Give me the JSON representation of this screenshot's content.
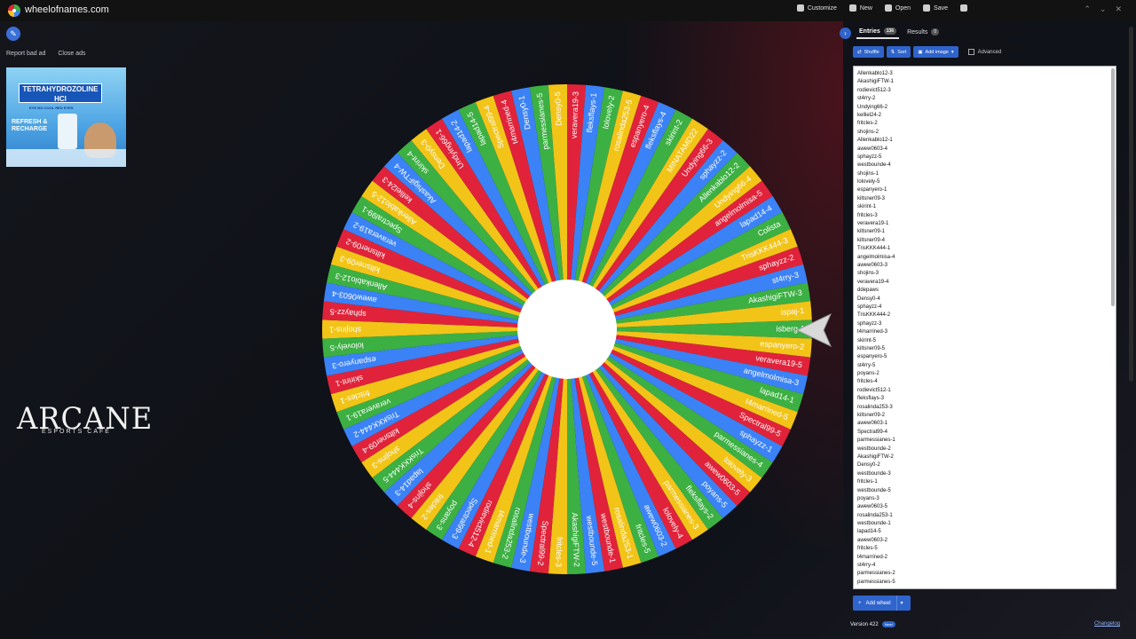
{
  "topbar": {
    "site_title": "wheelofnames.com",
    "actions": [
      {
        "label": "Customize",
        "icon": "palette-icon"
      },
      {
        "label": "New",
        "icon": "new-file-icon"
      },
      {
        "label": "Open",
        "icon": "folder-icon"
      },
      {
        "label": "Save",
        "icon": "save-icon"
      }
    ]
  },
  "ads": {
    "report_label": "Report bad ad",
    "close_label": "Close ads",
    "ad_title": "TETRAHYDROZOLINE HCl",
    "ad_sub": "EYE MO COOL RED EYES",
    "ad_refresh": "REFRESH & RECHARGE"
  },
  "branding": {
    "arcane_word": "ARCANE",
    "arcane_sub": "ESPORTS CAFE"
  },
  "panel": {
    "tabs": [
      {
        "label": "Entries",
        "count": "136"
      },
      {
        "label": "Results",
        "count": "0"
      }
    ],
    "tools": {
      "shuffle": "Shuffle",
      "sort": "Sort",
      "add_image": "Add image",
      "advanced": "Advanced"
    },
    "entries": [
      "Allenkablo12-3",
      "AkashigiFTW-1",
      "rodievict512-3",
      "st4rry-2",
      "Undying66-2",
      "kelliel24-2",
      "fritcles-2",
      "shojins-2",
      "Allenkablo12-1",
      "awew0603-4",
      "sphayzz-5",
      "westbounde-4",
      "shojins-1",
      "lolovely-5",
      "espanyero-1",
      "kiltsner09-3",
      "skirint-1",
      "fritcles-3",
      "veravera19-1",
      "kiltsner09-1",
      "kiltsner09-4",
      "TrisKKK444-1",
      "angelmolmisa-4",
      "awew0603-3",
      "shojins-3",
      "veravera19-4",
      "ddepaws",
      "Densy0-4",
      "sphayzz-4",
      "TrisKKK444-2",
      "sphayzz-3",
      "t4marrined-3",
      "skirint-5",
      "kiltsner09-5",
      "espanyero-5",
      "st4rry-5",
      "poyans-2",
      "fritcles-4",
      "rodievict512-1",
      "fleksflays-3",
      "rosalinda253-3",
      "kiltsner09-2",
      "awew0603-1",
      "Spectral99-4",
      "parmessianes-1",
      "westbounde-2",
      "AkashigiFTW-2",
      "Densy0-2",
      "westbounde-3",
      "fritcles-1",
      "westbounde-5",
      "poyans-3",
      "awew0603-5",
      "rosalinda253-1",
      "westbounde-1",
      "lapad14-5",
      "awew0603-2",
      "fritcles-5",
      "t4marrined-2",
      "st4rry-4",
      "parmessianes-2",
      "parmessianes-5"
    ],
    "add_wheel": "Add wheel",
    "version": "Version 422",
    "version_badge": "New!",
    "changelog": "Changelog"
  },
  "wheel": {
    "colors": [
      "#3cb043",
      "#f2c418",
      "#e0233a",
      "#3b82f6"
    ],
    "labels": [
      "isberg-1",
      "espanyero-2",
      "veravera19-5",
      "angelmolmisa-3",
      "lapad14-1",
      "t4marrined-5",
      "Spectral99-5",
      "sphayzz-1",
      "parmessianes-4",
      "lolovely-3",
      "awew0603-5",
      "poyans-5",
      "fleksflays-2",
      "parmessianes-3",
      "lolovely-4",
      "awew0603-2",
      "fritcles-5",
      "rosalinda253-1",
      "westbounde-1",
      "westbounde-5",
      "AkashigiFTW-2",
      "fritcles-3",
      "Spectral99-2",
      "westbounde-3",
      "rosalinda253-2",
      "t4marrined-1",
      "rodievict512-4",
      "Spectral99-3",
      "poyans-3",
      "fritcles-2",
      "shojins-4",
      "lapad14-3",
      "TrisKKK444-5",
      "shojins-3",
      "kiltsner09-4",
      "TrisKKK444-2",
      "veravera19-1",
      "fritcles-1",
      "skirint-1",
      "espanyero-3",
      "lolovely-5",
      "shojins-1",
      "sphayzz-5",
      "awew0603-4",
      "Allenkablo12-3",
      "kiltsner09-3",
      "kiltsner09-2",
      "veravera19-2",
      "Spectral99-1",
      "Allenkablo12-5",
      "kelliel24-3",
      "AkashigiFTW-4",
      "skirint-4",
      "Densy0-3",
      "Undying66-1",
      "lapad14-2",
      "lapad14-5",
      "Spectral99-4",
      "t4marrined-4",
      "Densy0-1",
      "parmessianes-5",
      "Densy0-5",
      "veravera19-3",
      "fleksflays-1",
      "lolovely-2",
      "rosalinda253-5",
      "espanyero-4",
      "fleksflays-4",
      "skirint-2",
      "MINATAMD22",
      "Undying66-3",
      "sphayzz-2",
      "Allenkablo12-2",
      "Undying66-4",
      "angelmolmisa-5",
      "lapad14-4",
      "Colista",
      "TrisKKK444-3",
      "sphayzz-2",
      "st4rry-3",
      "AkashigiFTW-3",
      "ispaj-1"
    ]
  }
}
